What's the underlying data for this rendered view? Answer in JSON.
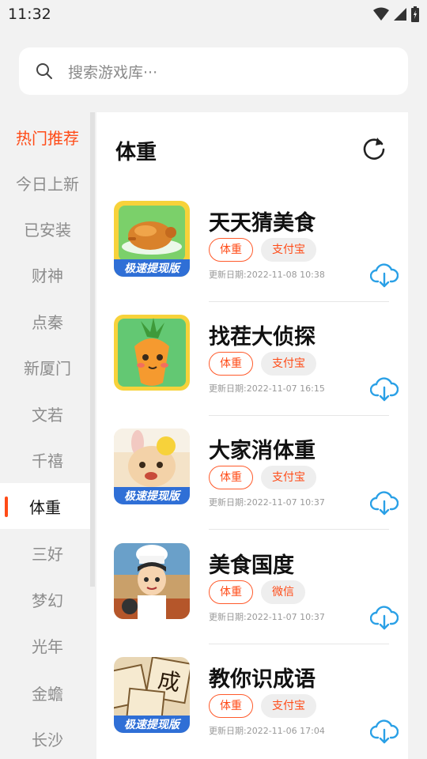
{
  "status_bar": {
    "time": "11:32"
  },
  "search": {
    "placeholder": "搜索游戏库···"
  },
  "sidebar": {
    "items": [
      {
        "label": "热门推荐"
      },
      {
        "label": "今日上新"
      },
      {
        "label": "已安装"
      },
      {
        "label": "财神"
      },
      {
        "label": "点秦"
      },
      {
        "label": "新厦门"
      },
      {
        "label": "文若"
      },
      {
        "label": "千禧"
      },
      {
        "label": "体重"
      },
      {
        "label": "三好"
      },
      {
        "label": "梦幻"
      },
      {
        "label": "光年"
      },
      {
        "label": "金蟾"
      },
      {
        "label": "长沙"
      }
    ],
    "active_index": 8,
    "hot_index": 0
  },
  "panel": {
    "title": "体重",
    "games": [
      {
        "name": "天天猜美食",
        "tag_category": "体重",
        "tag_payment": "支付宝",
        "update_date": "更新日期:2022-11-08 10:38",
        "icon": "roast-chicken-icon",
        "banner": "极速提现版"
      },
      {
        "name": "找茬大侦探",
        "tag_category": "体重",
        "tag_payment": "支付宝",
        "update_date": "更新日期:2022-11-07 16:15",
        "icon": "carrot-detective-icon",
        "banner": ""
      },
      {
        "name": "大家消体重",
        "tag_category": "体重",
        "tag_payment": "支付宝",
        "update_date": "更新日期:2022-11-07 10:37",
        "icon": "cartoon-characters-icon",
        "banner": "极速提现版"
      },
      {
        "name": "美食国度",
        "tag_category": "体重",
        "tag_payment": "微信",
        "update_date": "更新日期:2022-11-07 10:37",
        "icon": "chef-icon",
        "banner": ""
      },
      {
        "name": "教你识成语",
        "tag_category": "体重",
        "tag_payment": "支付宝",
        "update_date": "更新日期:2022-11-06 17:04",
        "icon": "idiom-tiles-icon",
        "banner": "极速提现版"
      }
    ]
  },
  "colors": {
    "accent": "#ff4b17",
    "download": "#2aa0e6",
    "background": "#f2f2f2"
  }
}
